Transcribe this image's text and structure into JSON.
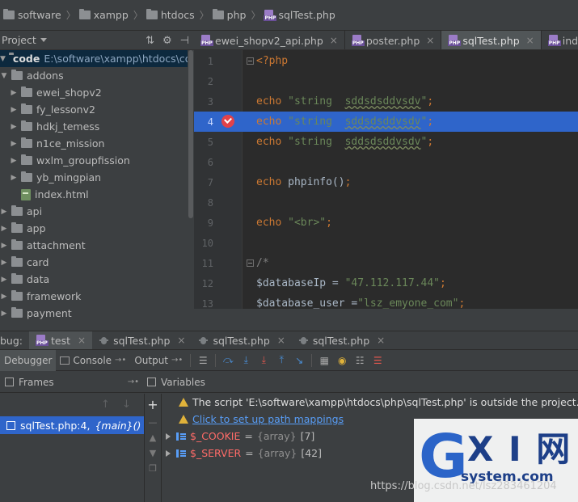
{
  "breadcrumb": [
    "software",
    "xampp",
    "htdocs",
    "php",
    "sqlTest.php"
  ],
  "project": {
    "title": "Project",
    "root_name": "code",
    "root_path": "E:\\software\\xampp\\htdocs\\code",
    "items": [
      {
        "label": "addons",
        "level": 1,
        "expanded": true
      },
      {
        "label": "ewei_shopv2",
        "level": 2
      },
      {
        "label": "fy_lessonv2",
        "level": 2
      },
      {
        "label": "hdkj_temess",
        "level": 2
      },
      {
        "label": "n1ce_mission",
        "level": 2
      },
      {
        "label": "wxlm_groupfission",
        "level": 2
      },
      {
        "label": "yb_mingpian",
        "level": 2
      },
      {
        "label": "index.html",
        "level": 2,
        "file": "html"
      },
      {
        "label": "api",
        "level": 1
      },
      {
        "label": "app",
        "level": 1
      },
      {
        "label": "attachment",
        "level": 1
      },
      {
        "label": "card",
        "level": 1
      },
      {
        "label": "data",
        "level": 1
      },
      {
        "label": "framework",
        "level": 1
      },
      {
        "label": "payment",
        "level": 1
      }
    ]
  },
  "editor_tabs": [
    {
      "label": "ewei_shopv2_api.php",
      "active": false
    },
    {
      "label": "poster.php",
      "active": false
    },
    {
      "label": "sqlTest.php",
      "active": true
    },
    {
      "label": "index.php",
      "active": false
    }
  ],
  "code_lines": [
    {
      "n": "1",
      "text": "<?php"
    },
    {
      "n": "2",
      "text": ""
    },
    {
      "n": "3",
      "text": "echo \"string  sddsdsddvsdv\";"
    },
    {
      "n": "4",
      "text": "echo \"string  sddsdsddvsdv\";"
    },
    {
      "n": "5",
      "text": "echo \"string  sddsdsddvsdv\";"
    },
    {
      "n": "6",
      "text": ""
    },
    {
      "n": "7",
      "text": "echo phpinfo();"
    },
    {
      "n": "8",
      "text": ""
    },
    {
      "n": "9",
      "text": "echo \"<br>\";"
    },
    {
      "n": "10",
      "text": ""
    },
    {
      "n": "11",
      "text": "/*"
    },
    {
      "n": "12",
      "text": "$databaseIp = \"47.112.117.44\";"
    },
    {
      "n": "13",
      "text": "$database_user =\"lsz_emyone_com\";"
    }
  ],
  "debug": {
    "label": "bug:",
    "tabs": [
      {
        "label": "test",
        "active": true
      },
      {
        "label": "sqlTest.php",
        "active": false
      },
      {
        "label": "sqlTest.php",
        "active": false
      },
      {
        "label": "sqlTest.php",
        "active": false
      }
    ],
    "subtabs": {
      "debugger": "Debugger",
      "console": "Console",
      "output": "Output"
    }
  },
  "frames": {
    "title": "Frames",
    "items": [
      {
        "file": "sqlTest.php:4,",
        "fn": "{main}()"
      }
    ]
  },
  "variables": {
    "title": "Variables",
    "warning": "The script 'E:\\software\\xampp\\htdocs\\php\\sqlTest.php' is outside the project.",
    "mapping_link": "Click to set up path mappings",
    "items": [
      {
        "name": "$_COOKIE",
        "eq": "=",
        "type": "{array}",
        "count": "[7]"
      },
      {
        "name": "$_SERVER",
        "eq": "=",
        "type": "{array}",
        "count": "[42]"
      }
    ]
  },
  "watermark": {
    "logo_g": "G",
    "logo_xi": "X I 网",
    "logo_site": "system.com",
    "url": "https://blog.csdn.net/lsz283461204"
  }
}
